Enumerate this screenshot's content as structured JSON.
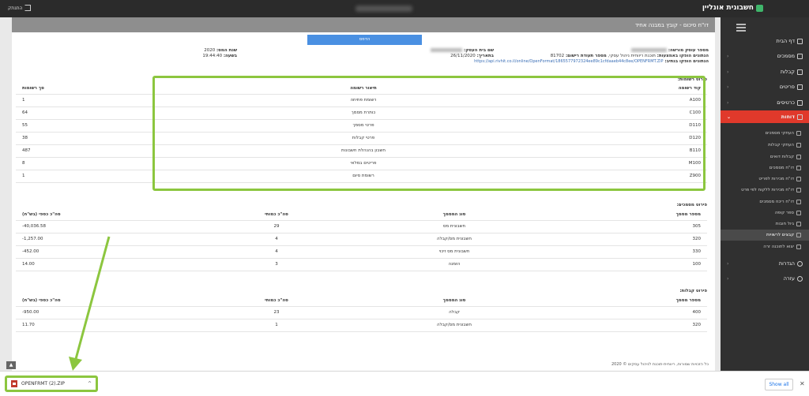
{
  "topbar": {
    "brand": "חשבונית אונליין",
    "logout": "התנתק"
  },
  "sidebar": {
    "items": [
      {
        "label": "דף הבית",
        "icon": "home-icon",
        "chevron": ""
      },
      {
        "label": "מסמכים",
        "icon": "document-icon",
        "chevron": "‹"
      },
      {
        "label": "קבלות",
        "icon": "receipt-icon",
        "chevron": "‹"
      },
      {
        "label": "פריטים",
        "icon": "items-icon",
        "chevron": "‹"
      },
      {
        "label": "כרטיסים",
        "icon": "user-icon",
        "chevron": "‹"
      },
      {
        "label": "דוחות",
        "icon": "reports-icon",
        "chevron": "⌄"
      }
    ],
    "subitems": [
      "העתקי מסמכים",
      "העתקי קבלות",
      "קבלות דואים",
      "דו\"ח מסמכים",
      "דו\"ח מכירות לפריט",
      "דו\"ח מכירות ללקוח לפי פרט",
      "דו\"ח ריכוז מסמכים",
      "ספר קופה",
      "גיול חובות",
      "קבצים לרשויות",
      "יצוא לתוכנה זרה"
    ],
    "bottom": [
      {
        "label": "הגדרות",
        "icon": "gear-icon",
        "chevron": "‹"
      },
      {
        "label": "עזרה",
        "icon": "help-icon",
        "chevron": "‹"
      }
    ]
  },
  "report": {
    "title": "דו\"ח סיכום - קובץ במבנה אחיד",
    "print": "הדפס",
    "left_info": {
      "tax_year_label": "שנת המס:",
      "tax_year": "2020",
      "time_label": "בשעה:",
      "time": "19:44:40"
    },
    "mid_info": {
      "business_label": "שם בית העסק:",
      "date_label": "בתאריך:",
      "date": "26/11/2020"
    },
    "right_info": {
      "dealer_label": "מספר עוסק מורשה:",
      "generated_label": "הנתונים הופקו באמצעות:",
      "generated_value": "תוכנת ריווחית ניהול עסקי,",
      "reg_label": "מספר תעודת רישום:",
      "reg_value": "81702",
      "saved_label": "הנתונים הופקו בנתיב:",
      "saved_value": "https://api.rivhit.co.il/online/OpenFormat/1865577972324ee89c1cfdaaeb44c8ee/OPENFRMT.ZIP"
    }
  },
  "records": {
    "title": "פירוט רשומות:",
    "headers": [
      "קוד רשומה",
      "תיאור רשומה",
      "סך רשומות"
    ],
    "rows": [
      [
        "A100",
        "רשומת פתיחה",
        "1"
      ],
      [
        "C100",
        "כותרת מסמך",
        "64"
      ],
      [
        "D110",
        "פרטי מסמך",
        "55"
      ],
      [
        "D120",
        "פרטי קבלות",
        "38"
      ],
      [
        "B110",
        "חשבון בהנהלת חשבונות",
        "487"
      ],
      [
        "M100",
        "פריטים במלאי",
        "8"
      ],
      [
        "Z900",
        "רשומת סיום",
        "1"
      ]
    ]
  },
  "documents": {
    "title": "פירוט מסמכים:",
    "headers": [
      "מספר מסמך",
      "סוג המסמך",
      "סה\"כ כמותי",
      "סה\"כ כספי (בש\"ח)"
    ],
    "rows": [
      [
        "305",
        "חשבונית מס",
        "29",
        "40,036.58-"
      ],
      [
        "320",
        "חשבונית מס/קבלה",
        "4",
        "1,257.00-"
      ],
      [
        "330",
        "חשבונית מס זיכוי",
        "4",
        "452.00-"
      ],
      [
        "100",
        "הזמנה",
        "3",
        "14.00"
      ]
    ]
  },
  "receipts": {
    "title": "פירוט קבלות:",
    "headers": [
      "מספר מסמך",
      "סוג המסמך",
      "סה\"כ כמותי",
      "סה\"כ כספי (בש\"ח)"
    ],
    "rows": [
      [
        "400",
        "קבלה",
        "23",
        "950.00-"
      ],
      [
        "320",
        "חשבונית מס/קבלה",
        "1",
        "11.70"
      ]
    ]
  },
  "footer": "כל הזכויות שמורות, ריווחית-תוכנת לניהול עסקים © 2020",
  "download": {
    "filename": "OPENFRMT (2).ZIP",
    "show_all": "Show all"
  },
  "colors": {
    "accent": "#e0392b",
    "highlight": "#8cc63f",
    "button": "#4a90e2"
  }
}
